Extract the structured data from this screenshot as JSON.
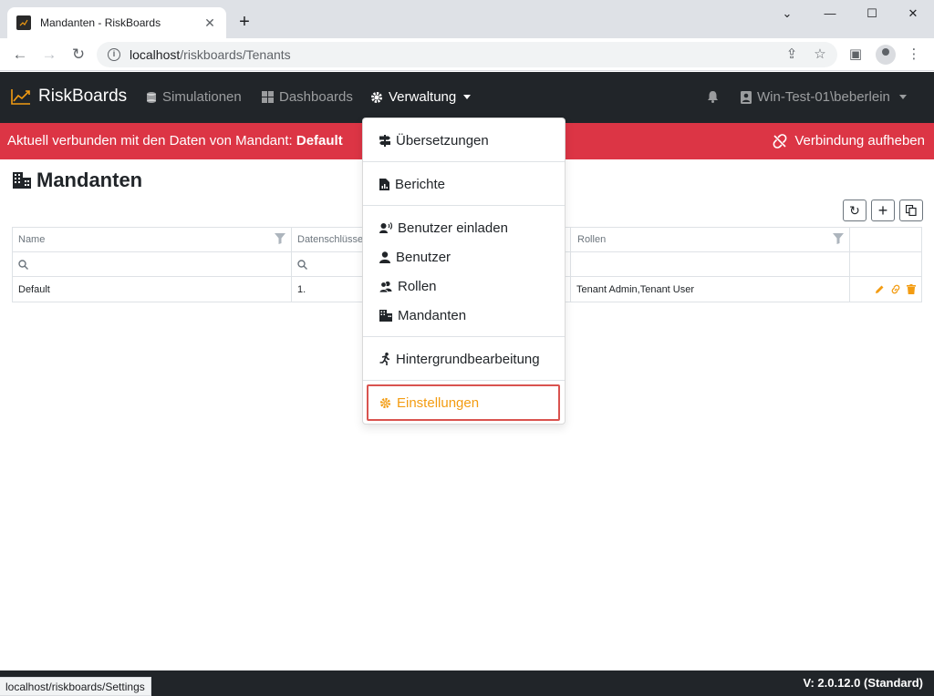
{
  "browser": {
    "tab_title": "Mandanten - RiskBoards",
    "url_host": "localhost",
    "url_path": "/riskboards/Tenants",
    "status_url": "localhost/riskboards/Settings"
  },
  "navbar": {
    "brand": "RiskBoards",
    "items": [
      {
        "label": "Simulationen",
        "icon": "database-icon"
      },
      {
        "label": "Dashboards",
        "icon": "grid-icon"
      },
      {
        "label": "Verwaltung",
        "icon": "gear-icon"
      }
    ],
    "user": "Win-Test-01\\beberlein"
  },
  "banner": {
    "message": "Aktuell verbunden mit den Daten von Mandant: ",
    "tenant": "Default",
    "disconnect_label": "Verbindung aufheben",
    "color": "#dc3545"
  },
  "page": {
    "title": "Mandanten"
  },
  "grid": {
    "columns": [
      "Name",
      "Datenschlüsse",
      "",
      "Rollen",
      ""
    ],
    "rows": [
      {
        "name": "Default",
        "key": "1.",
        "roles": "Tenant Admin,Tenant User"
      }
    ]
  },
  "dropdown": {
    "items": [
      {
        "label": "Übersetzungen",
        "icon": "signpost-icon"
      },
      {
        "label": "Berichte",
        "icon": "report-icon"
      },
      {
        "label": "Benutzer einladen",
        "icon": "user-invite-icon"
      },
      {
        "label": "Benutzer",
        "icon": "user-icon"
      },
      {
        "label": "Rollen",
        "icon": "users-icon"
      },
      {
        "label": "Mandanten",
        "icon": "building-icon"
      },
      {
        "label": "Hintergrundbearbeitung",
        "icon": "running-icon"
      },
      {
        "label": "Einstellungen",
        "icon": "gear-icon"
      }
    ],
    "highlight_color": "#f39c12"
  },
  "footer": {
    "version": "V: 2.0.12.0 (Standard)"
  }
}
